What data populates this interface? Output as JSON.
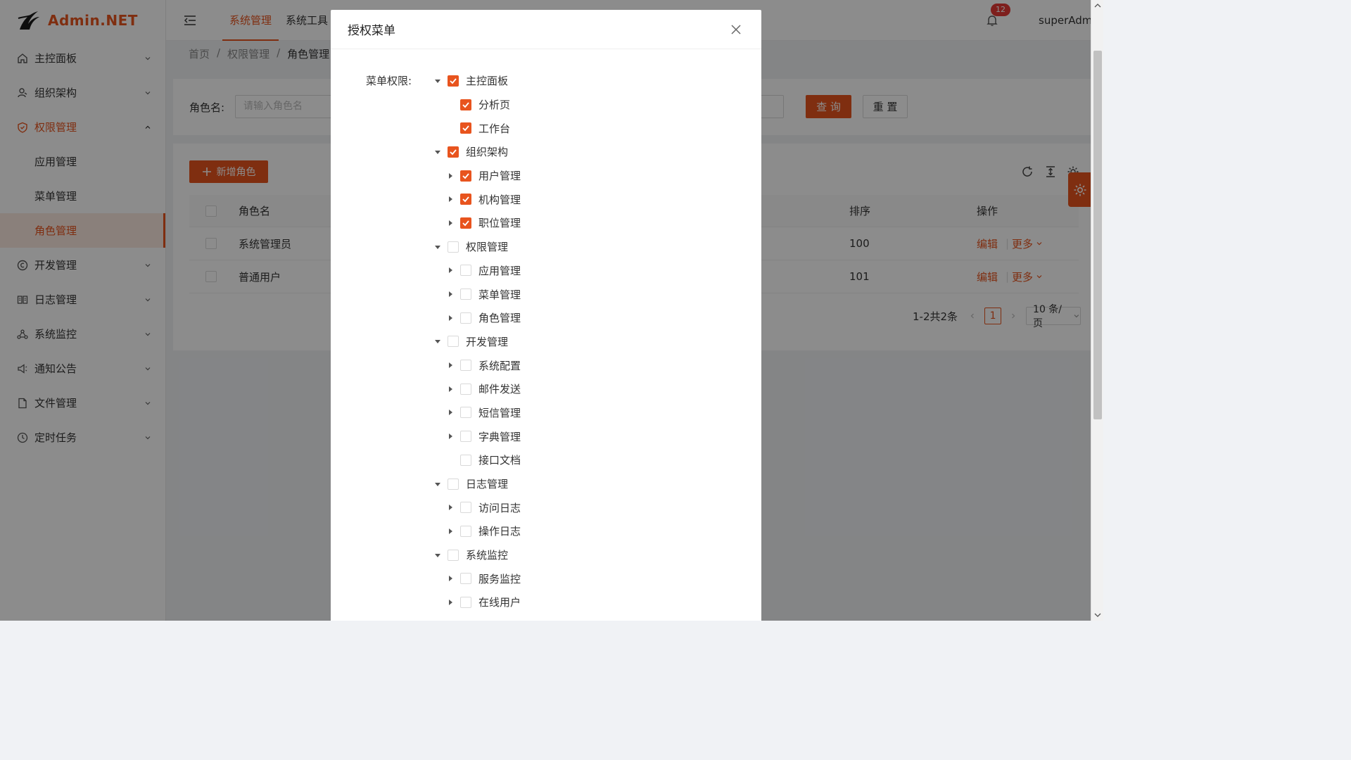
{
  "app": {
    "logo_text": "Admin.NET"
  },
  "sidebar": {
    "items": [
      {
        "label": "主控面板",
        "icon": "home-icon"
      },
      {
        "label": "组织架构",
        "icon": "org-icon"
      },
      {
        "label": "权限管理",
        "icon": "shield-icon"
      },
      {
        "label": "开发管理",
        "icon": "dev-icon"
      },
      {
        "label": "日志管理",
        "icon": "book-icon"
      },
      {
        "label": "系统监控",
        "icon": "monitor-icon"
      },
      {
        "label": "通知公告",
        "icon": "notice-icon"
      },
      {
        "label": "文件管理",
        "icon": "file-icon"
      },
      {
        "label": "定时任务",
        "icon": "clock-icon"
      }
    ],
    "sub_items": [
      {
        "label": "应用管理"
      },
      {
        "label": "菜单管理"
      },
      {
        "label": "角色管理"
      }
    ]
  },
  "header": {
    "tabs": [
      {
        "label": "系统管理"
      },
      {
        "label": "系统工具"
      }
    ],
    "notification_count": "12",
    "user_name": "superAdmin"
  },
  "breadcrumb": {
    "items": [
      "首页",
      "权限管理",
      "角色管理"
    ],
    "sep": "/"
  },
  "search": {
    "label": "角色名:",
    "placeholder": "请输入角色名",
    "query_label": "查 询",
    "reset_label": "重 置"
  },
  "table": {
    "add_label": "新增角色",
    "columns": {
      "name": "角色名",
      "sort": "排序",
      "action": "操作"
    },
    "rows": [
      {
        "name": "系统管理员",
        "sort": "100",
        "edit": "编辑",
        "more": "更多"
      },
      {
        "name": "普通用户",
        "sort": "101",
        "edit": "编辑",
        "more": "更多"
      }
    ],
    "pagination": {
      "total": "1-2共2条",
      "page": "1",
      "page_size": "10 条/页"
    }
  },
  "modal": {
    "title": "授权菜单",
    "form_label": "菜单权限:",
    "tree": [
      {
        "label": "主控面板",
        "level": 0,
        "expand": "open",
        "checked": true
      },
      {
        "label": "分析页",
        "level": 1,
        "expand": "none",
        "checked": true
      },
      {
        "label": "工作台",
        "level": 1,
        "expand": "none",
        "checked": true
      },
      {
        "label": "组织架构",
        "level": 0,
        "expand": "open",
        "checked": true
      },
      {
        "label": "用户管理",
        "level": 1,
        "expand": "closed",
        "checked": true
      },
      {
        "label": "机构管理",
        "level": 1,
        "expand": "closed",
        "checked": true
      },
      {
        "label": "职位管理",
        "level": 1,
        "expand": "closed",
        "checked": true
      },
      {
        "label": "权限管理",
        "level": 0,
        "expand": "open",
        "checked": false
      },
      {
        "label": "应用管理",
        "level": 1,
        "expand": "closed",
        "checked": false
      },
      {
        "label": "菜单管理",
        "level": 1,
        "expand": "closed",
        "checked": false
      },
      {
        "label": "角色管理",
        "level": 1,
        "expand": "closed",
        "checked": false
      },
      {
        "label": "开发管理",
        "level": 0,
        "expand": "open",
        "checked": false
      },
      {
        "label": "系统配置",
        "level": 1,
        "expand": "closed",
        "checked": false
      },
      {
        "label": "邮件发送",
        "level": 1,
        "expand": "closed",
        "checked": false
      },
      {
        "label": "短信管理",
        "level": 1,
        "expand": "closed",
        "checked": false
      },
      {
        "label": "字典管理",
        "level": 1,
        "expand": "closed",
        "checked": false
      },
      {
        "label": "接口文档",
        "level": 1,
        "expand": "none",
        "checked": false
      },
      {
        "label": "日志管理",
        "level": 0,
        "expand": "open",
        "checked": false
      },
      {
        "label": "访问日志",
        "level": 1,
        "expand": "closed",
        "checked": false
      },
      {
        "label": "操作日志",
        "level": 1,
        "expand": "closed",
        "checked": false
      },
      {
        "label": "系统监控",
        "level": 0,
        "expand": "open",
        "checked": false
      },
      {
        "label": "服务监控",
        "level": 1,
        "expand": "closed",
        "checked": false
      },
      {
        "label": "在线用户",
        "level": 1,
        "expand": "closed",
        "checked": false
      }
    ]
  },
  "colors": {
    "accent": "#e8541e",
    "mask": "rgba(0,0,0,0.45)"
  }
}
